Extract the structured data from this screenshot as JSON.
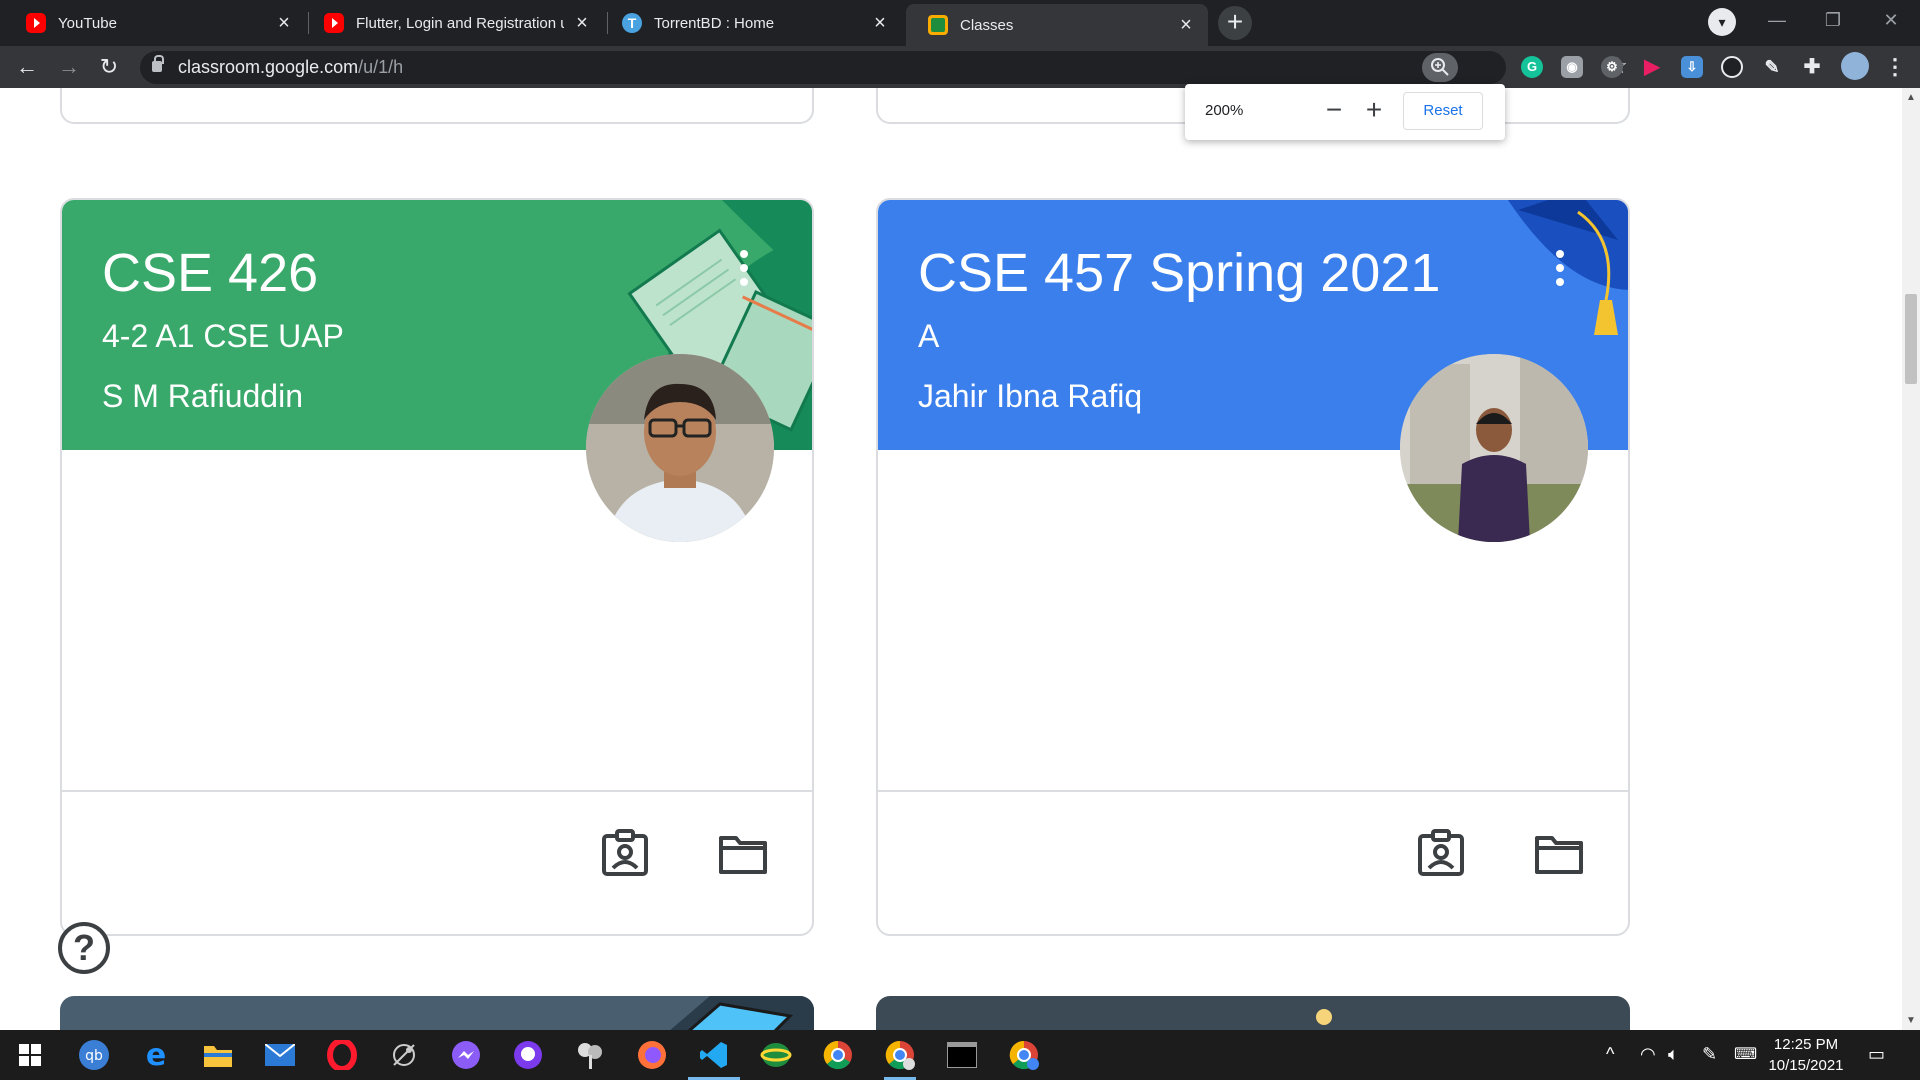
{
  "browser": {
    "tabs": [
      {
        "title": "YouTube",
        "icon": "youtube-icon"
      },
      {
        "title": "Flutter, Login and Registration us",
        "icon": "youtube-icon"
      },
      {
        "title": "TorrentBD : Home",
        "icon": "torrentbd-icon"
      },
      {
        "title": "Classes",
        "icon": "google-classroom-icon",
        "active": true
      }
    ],
    "close_glyph": "×",
    "new_tab_glyph": "+",
    "url_host": "classroom.google.com",
    "url_path": "/u/1/h",
    "zoom_popup": {
      "percent": "200%",
      "minus": "−",
      "plus": "+",
      "reset": "Reset"
    }
  },
  "classes": [
    {
      "title": "CSE 426",
      "section": "4-2 A1 CSE UAP",
      "teacher": "S M Rafiuddin",
      "theme_color": "#38a96a"
    },
    {
      "title": "CSE 457 Spring 2021",
      "section": "A",
      "teacher": "Jahir Ibna Rafiq",
      "theme_color": "#3a7fec"
    }
  ],
  "help_glyph": "?",
  "taskbar": {
    "time": "12:25 PM",
    "date": "10/15/2021",
    "apps": [
      "windows-start-icon",
      "qbittorrent-icon",
      "edge-icon",
      "file-explorer-icon",
      "mail-icon",
      "opera-icon",
      "satellite-icon",
      "messenger-icon",
      "github-desktop-icon",
      "pinwheel-icon",
      "firefox-icon",
      "vscode-icon",
      "globe-icon",
      "chrome-icon",
      "chrome-icon",
      "terminal-icon",
      "chrome-icon"
    ]
  }
}
